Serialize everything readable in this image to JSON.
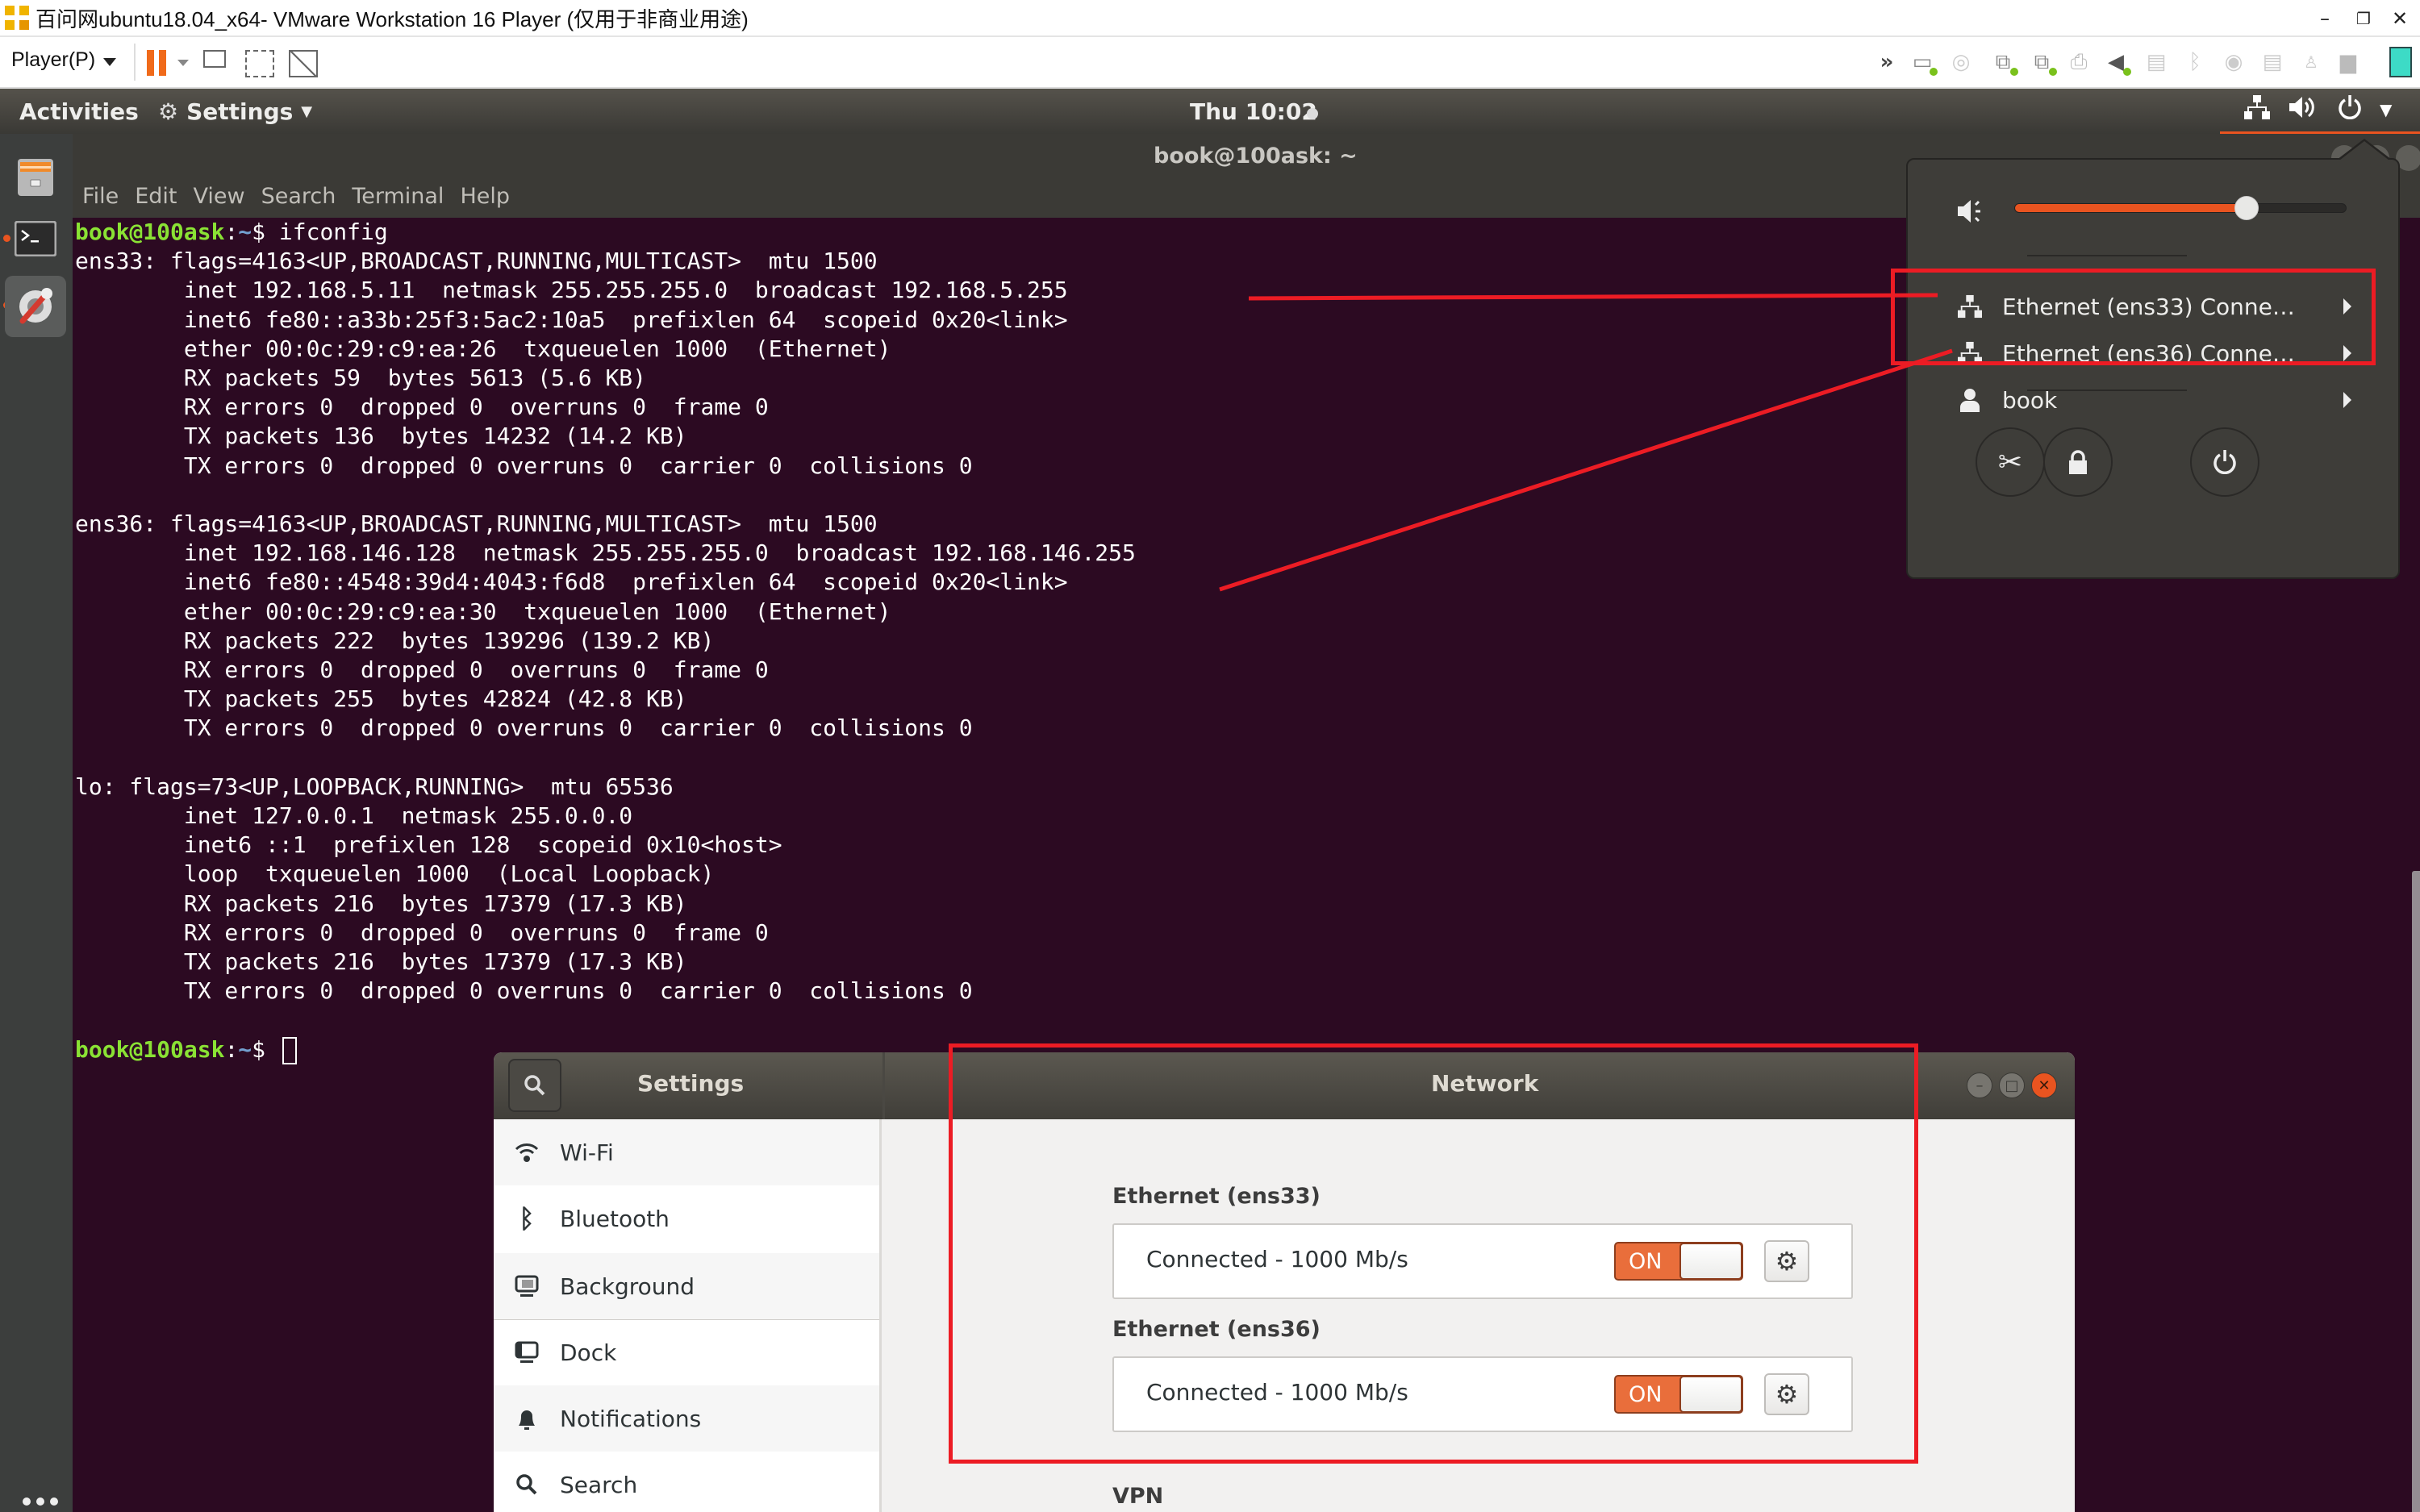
{
  "vmware": {
    "window_title": "百问网ubuntu18.04_x64- VMware Workstation 16 Player (仅用于非商业用途)",
    "player_menu_label": "Player(P)",
    "window_controls": {
      "minimize": "–",
      "restore": "❐",
      "close": "✕"
    },
    "toolbar_icons": [
      "pause-icon",
      "send-ctrl-alt-del-icon",
      "fit-guest-icon",
      "unity-mode-icon"
    ],
    "device_icons": [
      "more-icon",
      "hard-disk-icon",
      "cd-dvd-icon",
      "network-adapter-1-icon",
      "network-adapter-2-icon",
      "printer-icon",
      "sound-card-icon",
      "floppy-icon",
      "bluetooth-icon",
      "camera-icon",
      "floppy-2-icon",
      "audio-input-icon",
      "usb-icon",
      "message-log-icon"
    ]
  },
  "topbar": {
    "activities_label": "Activities",
    "app_menu_label": "Settings",
    "clock": "Thu 10:02",
    "status_icons": [
      "network-wired-icon",
      "volume-icon",
      "power-icon"
    ]
  },
  "dock": {
    "items": [
      {
        "name": "Files",
        "running": false
      },
      {
        "name": "Terminal",
        "running": true
      },
      {
        "name": "Settings",
        "running": true,
        "active": true
      }
    ],
    "show_apps_label": "Show Applications"
  },
  "terminal": {
    "title": "book@100ask: ~",
    "menu": [
      "File",
      "Edit",
      "View",
      "Search",
      "Terminal",
      "Help"
    ],
    "prompt_user": "book@100ask",
    "prompt_path": "~",
    "prompt_symbol": "$ ",
    "command": "ifconfig",
    "output_lines": [
      "ens33: flags=4163<UP,BROADCAST,RUNNING,MULTICAST>  mtu 1500",
      "        inet 192.168.5.11  netmask 255.255.255.0  broadcast 192.168.5.255",
      "        inet6 fe80::a33b:25f3:5ac2:10a5  prefixlen 64  scopeid 0x20<link>",
      "        ether 00:0c:29:c9:ea:26  txqueuelen 1000  (Ethernet)",
      "        RX packets 59  bytes 5613 (5.6 KB)",
      "        RX errors 0  dropped 0  overruns 0  frame 0",
      "        TX packets 136  bytes 14232 (14.2 KB)",
      "        TX errors 0  dropped 0 overruns 0  carrier 0  collisions 0",
      "",
      "ens36: flags=4163<UP,BROADCAST,RUNNING,MULTICAST>  mtu 1500",
      "        inet 192.168.146.128  netmask 255.255.255.0  broadcast 192.168.146.255",
      "        inet6 fe80::4548:39d4:4043:f6d8  prefixlen 64  scopeid 0x20<link>",
      "        ether 00:0c:29:c9:ea:30  txqueuelen 1000  (Ethernet)",
      "        RX packets 222  bytes 139296 (139.2 KB)",
      "        RX errors 0  dropped 0  overruns 0  frame 0",
      "        TX packets 255  bytes 42824 (42.8 KB)",
      "        TX errors 0  dropped 0 overruns 0  carrier 0  collisions 0",
      "",
      "lo: flags=73<UP,LOOPBACK,RUNNING>  mtu 65536",
      "        inet 127.0.0.1  netmask 255.0.0.0",
      "        inet6 ::1  prefixlen 128  scopeid 0x10<host>",
      "        loop  txqueuelen 1000  (Local Loopback)",
      "        RX packets 216  bytes 17379 (17.3 KB)",
      "        RX errors 0  dropped 0  overruns 0  frame 0",
      "        TX packets 216  bytes 17379 (17.3 KB)",
      "        TX errors 0  dropped 0 overruns 0  carrier 0  collisions 0",
      ""
    ]
  },
  "system_menu": {
    "volume_percent": 70,
    "items": [
      {
        "label": "Ethernet (ens33) Conne…",
        "icon": "network-wired-icon"
      },
      {
        "label": "Ethernet (ens36) Conne…",
        "icon": "network-wired-icon"
      },
      {
        "label": "book",
        "icon": "user-icon"
      }
    ],
    "buttons": [
      "settings-tools-icon",
      "lock-icon",
      "power-icon"
    ]
  },
  "settings": {
    "sidebar_title": "Settings",
    "main_title": "Network",
    "sidebar_items": [
      {
        "label": "Wi-Fi",
        "icon": "wifi-icon"
      },
      {
        "label": "Bluetooth",
        "icon": "bluetooth-icon"
      },
      {
        "label": "Background",
        "icon": "background-icon"
      },
      {
        "label": "Dock",
        "icon": "dock-icon"
      },
      {
        "label": "Notifications",
        "icon": "bell-icon"
      },
      {
        "label": "Search",
        "icon": "search-icon"
      }
    ],
    "sections": [
      {
        "title": "Ethernet (ens33)",
        "status": "Connected - 1000 Mb/s",
        "toggle": "ON"
      },
      {
        "title": "Ethernet (ens36)",
        "status": "Connected - 1000 Mb/s",
        "toggle": "ON"
      }
    ],
    "vpn_title": "VPN",
    "add_symbol": "+"
  },
  "colors": {
    "accent": "#e95420",
    "terminal_bg": "#2c0a22",
    "prompt_user": "#8ae234",
    "prompt_path": "#729fcf",
    "annotation_red": "#ec1c24"
  }
}
